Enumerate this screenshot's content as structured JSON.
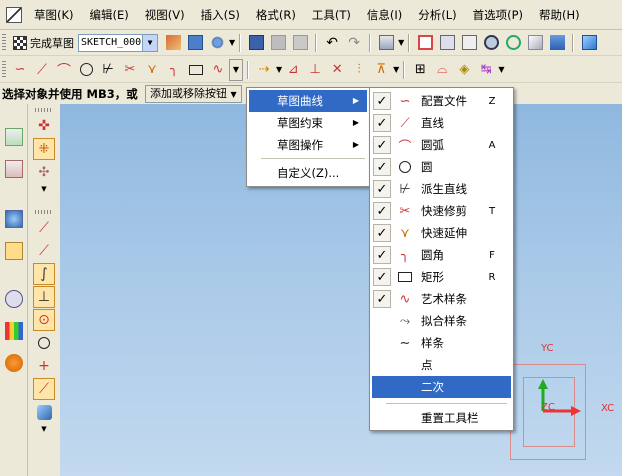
{
  "menubar": {
    "items": [
      "草图(K)",
      "编辑(E)",
      "视图(V)",
      "插入(S)",
      "格式(R)",
      "工具(T)",
      "信息(I)",
      "分析(L)",
      "首选项(P)",
      "帮助(H)"
    ]
  },
  "toolbar": {
    "finish_label": "完成草图",
    "sketch_name": "SKETCH_000"
  },
  "status": {
    "prompt": "选择对象并使用 MB3，或",
    "add_remove_label": "添加或移除按钮"
  },
  "menu1": {
    "items": [
      {
        "label": "草图曲线",
        "has_sub": true,
        "selected": true
      },
      {
        "label": "草图约束",
        "has_sub": true
      },
      {
        "label": "草图操作",
        "has_sub": true
      },
      {
        "label": "自定义(Z)..."
      }
    ]
  },
  "menu2": {
    "items": [
      {
        "label": "配置文件",
        "key": "Z",
        "checked": true,
        "icon": "profile-icon"
      },
      {
        "label": "直线",
        "key": "",
        "checked": true,
        "icon": "line-icon"
      },
      {
        "label": "圆弧",
        "key": "A",
        "checked": true,
        "icon": "arc-icon"
      },
      {
        "label": "圆",
        "key": "",
        "checked": true,
        "icon": "circle-icon"
      },
      {
        "label": "派生直线",
        "key": "",
        "checked": true,
        "icon": "derived-line-icon"
      },
      {
        "label": "快速修剪",
        "key": "T",
        "checked": true,
        "icon": "quick-trim-icon"
      },
      {
        "label": "快速延伸",
        "key": "",
        "checked": true,
        "icon": "quick-extend-icon"
      },
      {
        "label": "圆角",
        "key": "F",
        "checked": true,
        "icon": "fillet-icon"
      },
      {
        "label": "矩形",
        "key": "R",
        "checked": true,
        "icon": "rectangle-icon"
      },
      {
        "label": "艺术样条",
        "key": "",
        "checked": true,
        "icon": "studio-spline-icon"
      },
      {
        "label": "拟合样条",
        "key": "",
        "checked": false,
        "icon": "fit-spline-icon"
      },
      {
        "label": "样条",
        "key": "",
        "checked": false,
        "icon": "spline-icon"
      },
      {
        "label": "点",
        "key": "",
        "checked": false,
        "icon": ""
      },
      {
        "label": "二次",
        "key": "",
        "checked": false,
        "icon": "",
        "highlighted": true
      }
    ],
    "reset_label": "重置工具栏"
  },
  "triad": {
    "x_label": "XC",
    "y_label": "YC",
    "z_label": "ZC"
  }
}
